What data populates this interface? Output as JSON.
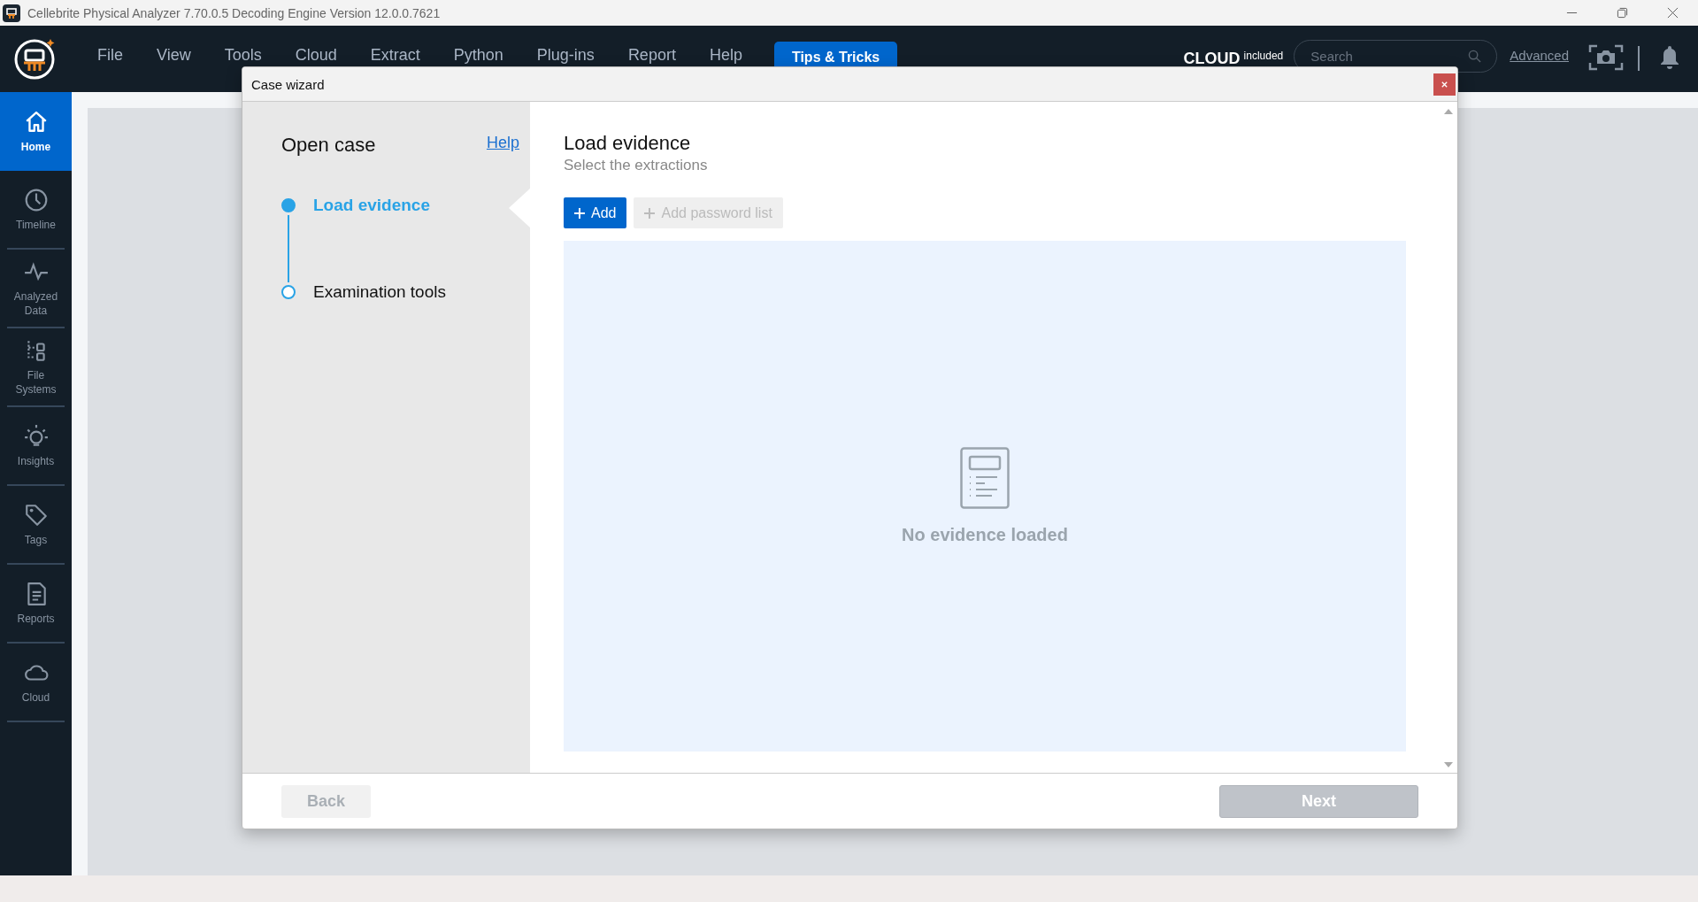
{
  "window": {
    "title": "Cellebrite Physical Analyzer 7.70.0.5  Decoding Engine Version 12.0.0.7621"
  },
  "menu": [
    {
      "label": "File"
    },
    {
      "label": "View"
    },
    {
      "label": "Tools"
    },
    {
      "label": "Cloud"
    },
    {
      "label": "Extract"
    },
    {
      "label": "Python"
    },
    {
      "label": "Plug-ins"
    },
    {
      "label": "Report"
    },
    {
      "label": "Help"
    }
  ],
  "tips_button": "Tips & Tricks",
  "cloud_badge": {
    "label": "CLOUD",
    "suffix": "included"
  },
  "search": {
    "placeholder": "Search"
  },
  "advanced_link": "Advanced",
  "sidebar": {
    "items": [
      {
        "label": "Home",
        "kind": "home",
        "selected": true
      },
      {
        "label": "Timeline",
        "kind": "timeline",
        "selected": false
      },
      {
        "label": "Analyzed Data",
        "kind": "analyzed",
        "selected": false
      },
      {
        "label": "File Systems",
        "kind": "filesystems",
        "selected": false
      },
      {
        "label": "Insights",
        "kind": "insights",
        "selected": false
      },
      {
        "label": "Tags",
        "kind": "tags",
        "selected": false
      },
      {
        "label": "Reports",
        "kind": "reports",
        "selected": false
      },
      {
        "label": "Cloud",
        "kind": "cloud",
        "selected": false
      }
    ]
  },
  "dialog": {
    "title": "Case wizard",
    "heading": "Open case",
    "help_link": "Help",
    "steps": [
      {
        "label": "Load evidence",
        "selected": true
      },
      {
        "label": "Examination tools",
        "selected": false
      }
    ],
    "content": {
      "title": "Load evidence",
      "subtitle": "Select the extractions",
      "buttons": [
        {
          "label": "Add",
          "disabled": false
        },
        {
          "label": "Add password list",
          "disabled": true
        }
      ],
      "empty_message": "No evidence loaded"
    },
    "footer": {
      "back": {
        "label": "Back",
        "disabled": true
      },
      "next": {
        "label": "Next",
        "disabled": true
      }
    }
  }
}
